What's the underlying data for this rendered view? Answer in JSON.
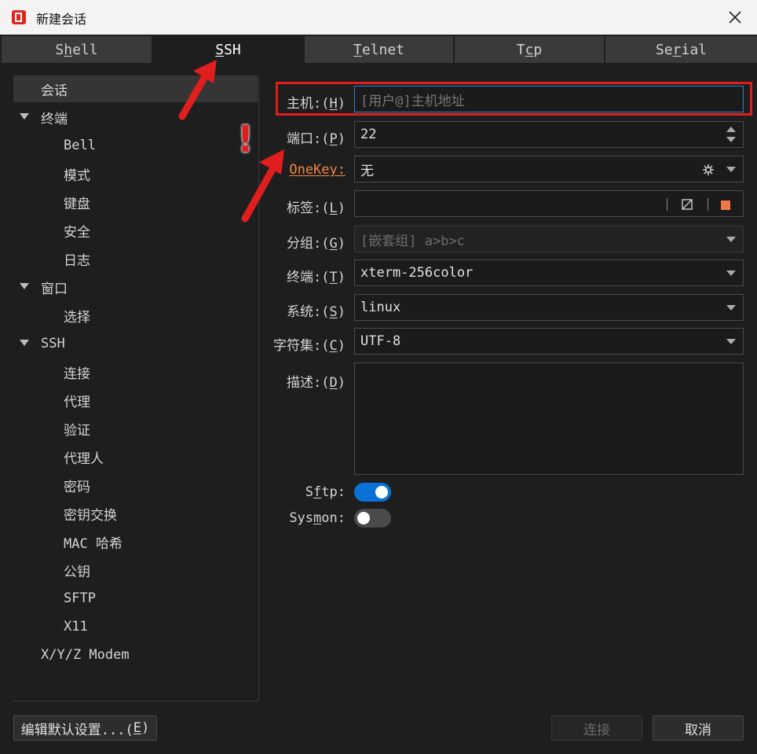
{
  "window": {
    "title": "新建会话",
    "accent": "#e2231a"
  },
  "tabs": [
    {
      "label": "Shell",
      "active": false
    },
    {
      "label": "SSH",
      "active": true
    },
    {
      "label": "Telnet",
      "active": false
    },
    {
      "label": "Tcp",
      "active": false
    },
    {
      "label": "Serial",
      "active": false
    }
  ],
  "sidebar": {
    "items": [
      {
        "label": "会话",
        "level": 0,
        "selected": true
      },
      {
        "label": "终端",
        "level": 0,
        "expanded": true
      },
      {
        "label": "Bell",
        "level": 1
      },
      {
        "label": "模式",
        "level": 1
      },
      {
        "label": "键盘",
        "level": 1
      },
      {
        "label": "安全",
        "level": 1
      },
      {
        "label": "日志",
        "level": 1
      },
      {
        "label": "窗口",
        "level": 0,
        "expanded": true
      },
      {
        "label": "选择",
        "level": 1
      },
      {
        "label": "SSH",
        "level": 0,
        "expanded": true
      },
      {
        "label": "连接",
        "level": 1
      },
      {
        "label": "代理",
        "level": 1
      },
      {
        "label": "验证",
        "level": 1
      },
      {
        "label": "代理人",
        "level": 1
      },
      {
        "label": "密码",
        "level": 1
      },
      {
        "label": "密钥交换",
        "level": 1
      },
      {
        "label": "MAC 哈希",
        "level": 1
      },
      {
        "label": "公钥",
        "level": 1
      },
      {
        "label": "SFTP",
        "level": 1
      },
      {
        "label": "X11",
        "level": 1
      },
      {
        "label": "X/Y/Z Modem",
        "level": 0
      }
    ]
  },
  "form": {
    "host": {
      "label": "主机:(",
      "key": "H",
      "suffix": ")",
      "placeholder": "[用户@]主机地址",
      "value": ""
    },
    "port": {
      "label": "端口:(",
      "key": "P",
      "suffix": ")",
      "value": "22"
    },
    "onekey": {
      "label": "OneKey:",
      "value": "无"
    },
    "tag": {
      "label": "标签:(",
      "key": "L",
      "suffix": ")",
      "value": "",
      "swatch_color": "#f0784a"
    },
    "group": {
      "label": "分组:(",
      "key": "G",
      "suffix": ")",
      "value": "[嵌套组] a>b>c"
    },
    "terminal": {
      "label": "终端:(",
      "key": "T",
      "suffix": ")",
      "value": "xterm-256color"
    },
    "system": {
      "label": "系统:(",
      "key": "S",
      "suffix": ")",
      "value": "linux"
    },
    "charset": {
      "label": "字符集:(",
      "key": "C",
      "suffix": ")",
      "value": "UTF-8"
    },
    "description": {
      "label": "描述:(",
      "key": "D",
      "suffix": ")",
      "value": ""
    },
    "sftp": {
      "label_pre": "S",
      "key": "f",
      "label_post": "tp:",
      "on": true,
      "on_color": "#0a72d6"
    },
    "sysmon": {
      "label_pre": "Sys",
      "key": "m",
      "label_post": "on:",
      "on": false,
      "off_color": "#4a4a4a"
    }
  },
  "footer": {
    "edit_defaults": {
      "label": "编辑默认设置...(",
      "key": "E",
      "suffix": ")"
    },
    "connect": {
      "label": "连接",
      "disabled": true
    },
    "cancel": {
      "label": "取消"
    }
  },
  "annotation": {
    "mark": "!",
    "color": "#e01e1e"
  }
}
